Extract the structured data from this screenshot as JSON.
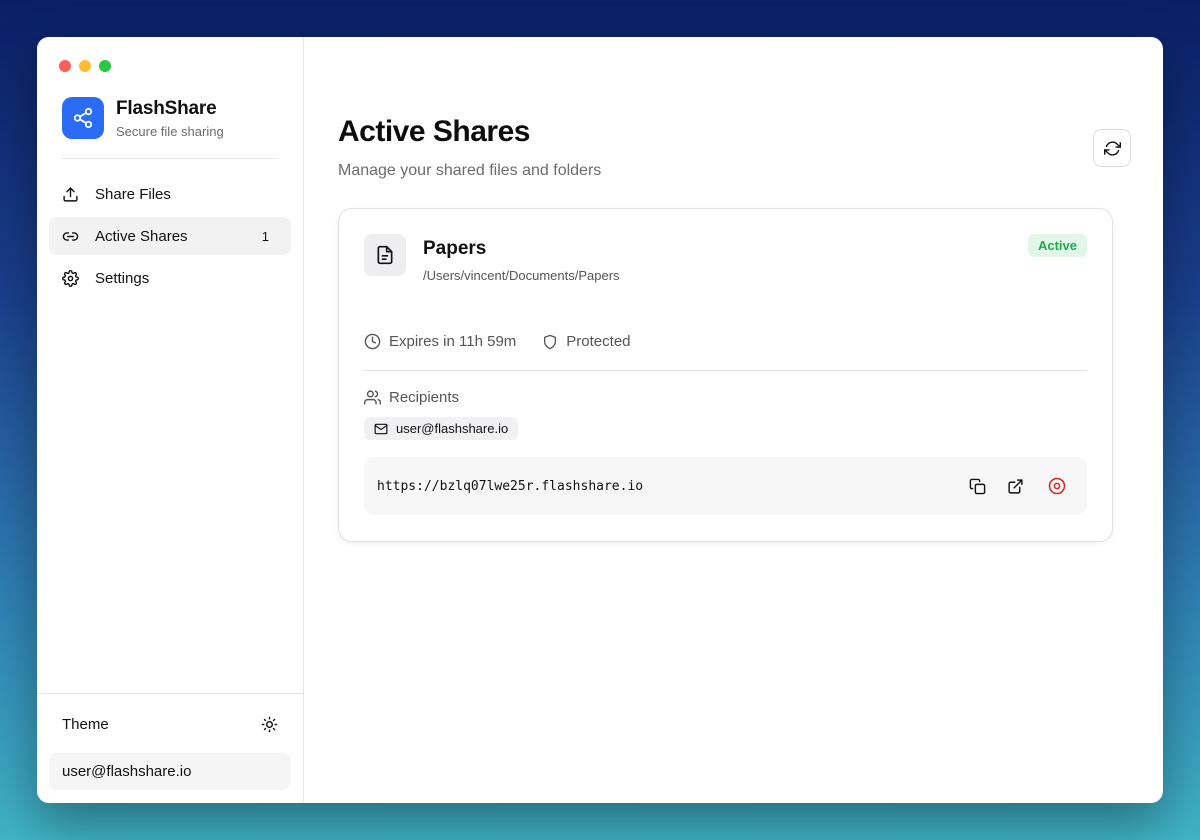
{
  "app": {
    "name": "FlashShare",
    "tagline": "Secure file sharing"
  },
  "sidebar": {
    "items": [
      {
        "label": "Share Files",
        "icon": "upload-icon"
      },
      {
        "label": "Active Shares",
        "icon": "link-icon",
        "badge": "1"
      },
      {
        "label": "Settings",
        "icon": "gear-icon"
      }
    ],
    "theme_label": "Theme",
    "theme_icon": "sun-icon",
    "user_email": "user@flashshare.io"
  },
  "main": {
    "title": "Active Shares",
    "subtitle": "Manage your shared files and folders",
    "refresh_icon": "refresh-icon"
  },
  "share": {
    "name": "Papers",
    "path": "/Users/vincent/Documents/Papers",
    "status": "Active",
    "expires": "Expires in 11h 59m",
    "protection": "Protected",
    "recipients_label": "Recipients",
    "recipients": [
      "user@flashshare.io"
    ],
    "url": "https://bzlq07lwe25r.flashshare.io"
  },
  "colors": {
    "accent": "#2a6cf6",
    "active_badge_bg": "#e3f7e9",
    "active_badge_text": "#23a94d",
    "danger": "#e02424"
  }
}
